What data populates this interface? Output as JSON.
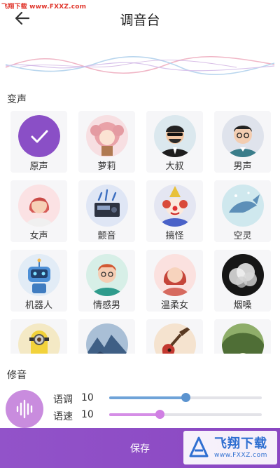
{
  "watermark": {
    "top_text": "飞翔下载 www.FXXZ.com"
  },
  "header": {
    "title": "调音台"
  },
  "sections": {
    "voice_change": "变声",
    "tuning": "修音"
  },
  "voices": [
    {
      "label": "原声",
      "icon": "check-icon",
      "selected": true
    },
    {
      "label": "萝莉",
      "icon": "loli-avatar-icon"
    },
    {
      "label": "大叔",
      "icon": "uncle-avatar-icon"
    },
    {
      "label": "男声",
      "icon": "male-avatar-icon"
    },
    {
      "label": "女声",
      "icon": "female-avatar-icon"
    },
    {
      "label": "颤音",
      "icon": "vibrato-speaker-icon"
    },
    {
      "label": "搞怪",
      "icon": "clown-avatar-icon"
    },
    {
      "label": "空灵",
      "icon": "ethereal-whale-icon"
    },
    {
      "label": "机器人",
      "icon": "robot-avatar-icon"
    },
    {
      "label": "情感男",
      "icon": "emotional-man-avatar-icon"
    },
    {
      "label": "温柔女",
      "icon": "gentle-woman-avatar-icon"
    },
    {
      "label": "烟嗓",
      "icon": "smoke-icon"
    },
    {
      "label": "",
      "icon": "minion-icon"
    },
    {
      "label": "",
      "icon": "mountain-icon"
    },
    {
      "label": "",
      "icon": "guitar-icon"
    },
    {
      "label": "",
      "icon": "cave-icon"
    }
  ],
  "tuning": {
    "pitch": {
      "label": "语调",
      "value": "10",
      "level": 0.5
    },
    "speed": {
      "label": "语速",
      "value": "10",
      "level": 0.33
    }
  },
  "footer": {
    "save_label": "保存"
  },
  "logo": {
    "text": "飞翔下载",
    "url": "www.FXXZ.com"
  },
  "colors": {
    "accent": "#8c4bc4",
    "selected": "#8a4fc6",
    "pitch": "#5b93cf",
    "speed": "#d07fe3"
  }
}
